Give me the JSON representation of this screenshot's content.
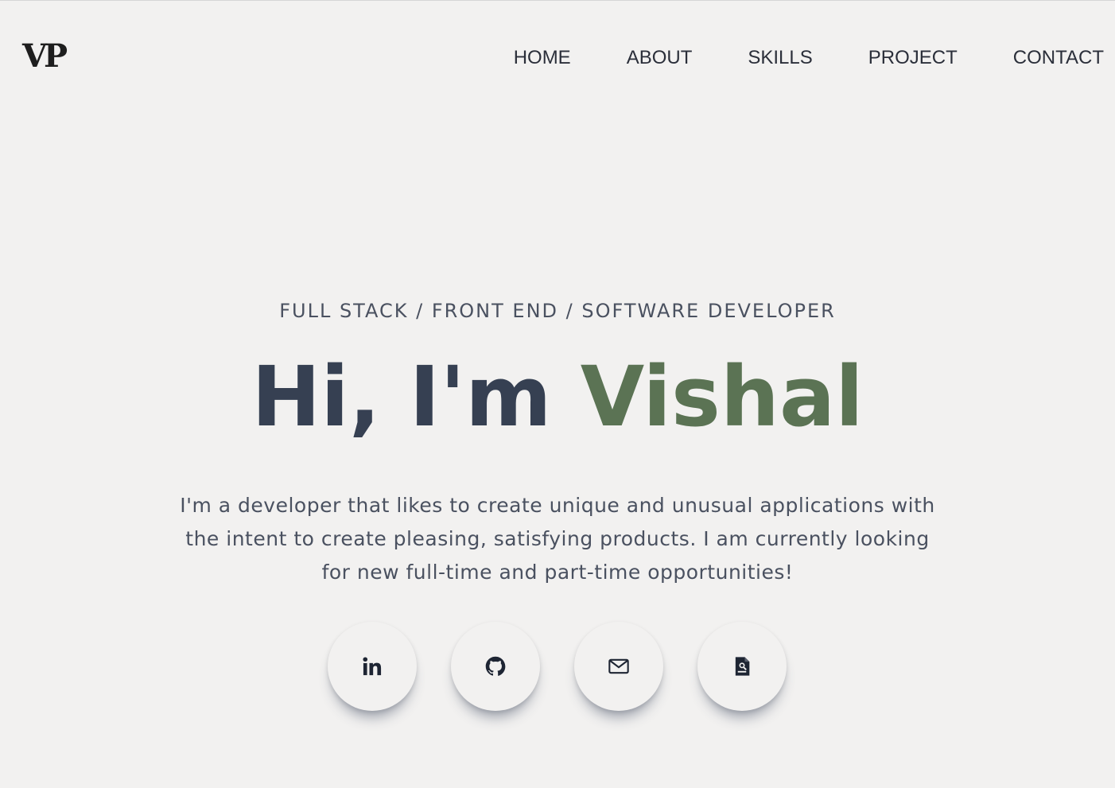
{
  "header": {
    "logo": "VP",
    "nav": [
      {
        "label": "HOME"
      },
      {
        "label": "ABOUT"
      },
      {
        "label": "SKILLS"
      },
      {
        "label": "PROJECT"
      },
      {
        "label": "CONTACT"
      }
    ]
  },
  "hero": {
    "roles": "FULL STACK / FRONT END / SOFTWARE DEVELOPER",
    "greeting": "Hi, I'm",
    "name": "Vishal",
    "bio": "I'm a developer that likes to create unique and unusual applications with the intent to create pleasing, satisfying products. I am currently looking for new full-time and part-time opportunities!"
  },
  "socials": [
    {
      "icon": "linkedin-icon"
    },
    {
      "icon": "github-icon"
    },
    {
      "icon": "mail-icon"
    },
    {
      "icon": "resume-icon"
    }
  ],
  "colors": {
    "background": "#f2f1f0",
    "heading": "#364052",
    "accent": "#5b7354",
    "text": "#4a5160"
  }
}
